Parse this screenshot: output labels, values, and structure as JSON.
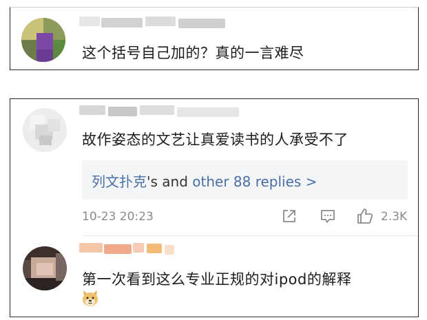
{
  "comments": [
    {
      "text": "这个括号自己加的？真的一言难尽"
    },
    {
      "text": "故作姿态的文艺让真爱读书的人承受不了",
      "replies": {
        "first_replier": "列文扑克",
        "mid": "'s and ",
        "more": "other 88 replies >"
      },
      "timestamp": "10-23 20:23",
      "like_count": "2.3K"
    },
    {
      "text": "第一次看到这么专业正规的对ipod的解释",
      "emoji": "doge-emoji"
    }
  ],
  "colors": {
    "link_blue": "#4a6fa5",
    "meta_gray": "#8a8a8a",
    "reply_bg": "#f4f5f7"
  },
  "icons": [
    "share-icon",
    "comment-icon",
    "thumbs-up-icon"
  ]
}
